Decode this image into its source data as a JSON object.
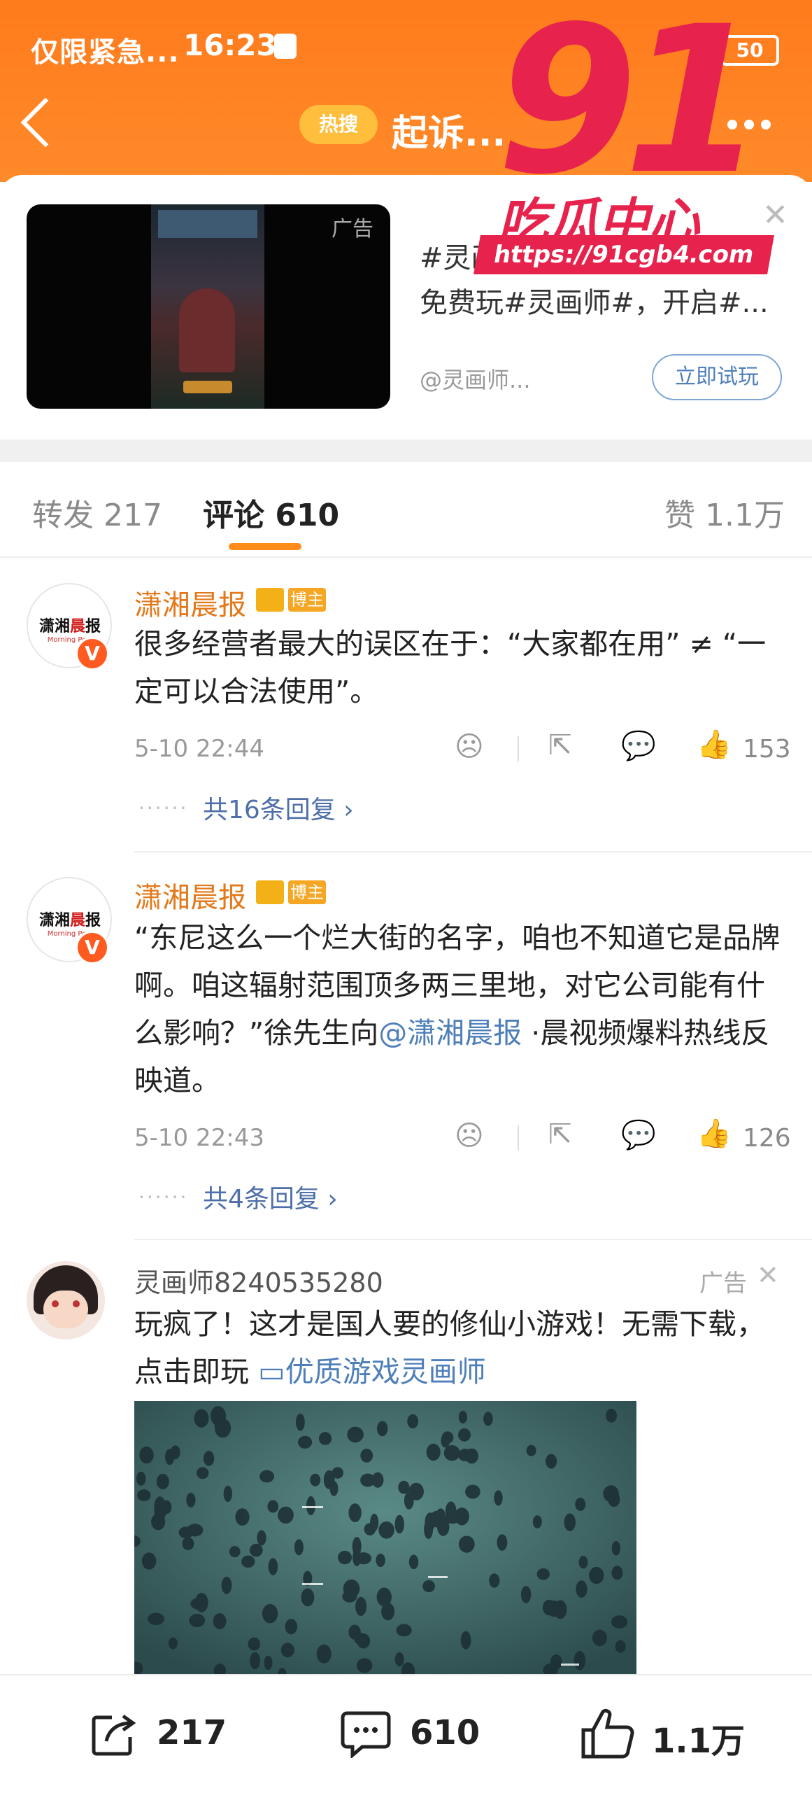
{
  "status_bar": {
    "left_text": "仅限紧急...",
    "time": "16:23",
    "battery": "50"
  },
  "header": {
    "hot_label": "热搜",
    "title": "起诉..."
  },
  "watermark": {
    "big": "91",
    "text": "吃瓜中心",
    "url": "https://91cgb4.com"
  },
  "ad_card": {
    "tag": "广告",
    "line1": "#灵画师#，",
    "line2": "免费玩#灵画师#，开启#...",
    "source": "@灵画师...",
    "button": "立即试玩"
  },
  "tabs": {
    "repost": "转发 217",
    "comment": "评论 610",
    "like": "赞 1.1万"
  },
  "comments": [
    {
      "avatar_text_a": "潇湘",
      "avatar_text_b": "晨",
      "avatar_text_c": "报",
      "avatar_sub": "Morning Post",
      "name": "潇湘晨报",
      "badge": "博主",
      "text": "很多经营者最大的误区在于：“大家都在用” ≠ “一定可以合法使用”。",
      "time": "5-10 22:44",
      "likes": "153",
      "replies": "共16条回复 ›"
    },
    {
      "avatar_text_a": "潇湘",
      "avatar_text_b": "晨",
      "avatar_text_c": "报",
      "avatar_sub": "Morning Post",
      "name": "潇湘晨报",
      "badge": "博主",
      "text_a": "“东尼这么一个烂大街的名字，咱也不知道它是品牌啊。咱这辐射范围顶多两三里地，对它公司能有什么影响？”徐先生向",
      "mention": "@潇湘晨报",
      "text_b": " ·晨视频爆料热线反映道。",
      "time": "5-10 22:43",
      "likes": "126",
      "replies": "共4条回复 ›"
    }
  ],
  "ad_comment": {
    "name": "灵画师8240535280",
    "tag": "广告",
    "text": "玩疯了！这才是国人要的修仙小游戏！无需下载，点击即玩",
    "link": "优质游戏灵画师"
  },
  "bottom_bar": {
    "repost": "217",
    "comment": "610",
    "like": "1.1万"
  },
  "icons": {
    "back": "back-arrow-icon",
    "more": "more-dots-icon",
    "dislike": "frown-icon",
    "share": "share-icon",
    "reply": "comment-icon",
    "like": "thumbs-up-icon",
    "close": "close-icon",
    "video": "video-icon"
  },
  "colors": {
    "header_orange": "#ff7b1c",
    "accent_orange": "#ff8b1a",
    "watermark_red": "#e7234d",
    "link_blue": "#4f7fb8",
    "name_orange": "#e3791a"
  }
}
